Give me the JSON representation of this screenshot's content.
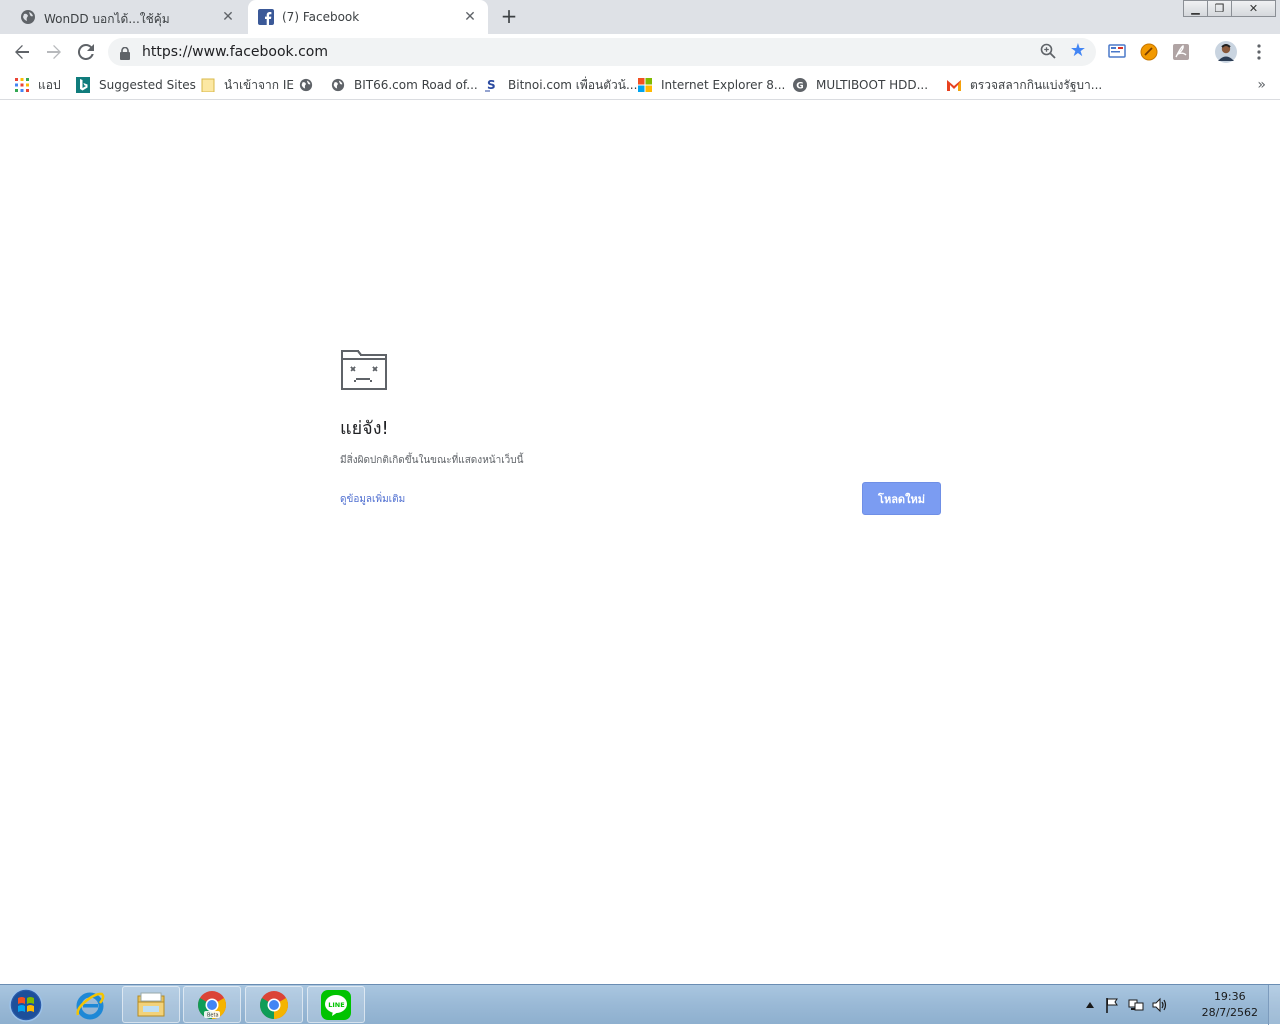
{
  "browser": {
    "tabs": [
      {
        "title": "WonDD บอกได้...ใช้คุ้ม",
        "favicon": "globe-icon",
        "active": false
      },
      {
        "title": "(7) Facebook",
        "favicon": "facebook-icon",
        "active": true
      }
    ],
    "new_tab_label": "+",
    "window_controls": {
      "minimize": "▁",
      "restore": "❐",
      "close": "✕"
    },
    "address_bar": {
      "url": "https://www.facebook.com"
    },
    "bookmarks": [
      {
        "label": "แอป",
        "icon": "apps-grid-icon"
      },
      {
        "label": "Suggested Sites",
        "icon": "bing-icon"
      },
      {
        "label": "นำเข้าจาก IE",
        "icon": "folder-icon"
      },
      {
        "label": "",
        "icon": "globe-icon"
      },
      {
        "label": "BIT66.com Road of...",
        "icon": "globe-icon"
      },
      {
        "label": "Bitnoi.com เพื่อนตัวน้...",
        "icon": "bitnoi-icon"
      },
      {
        "label": "Internet Explorer 8...",
        "icon": "windows-logo-icon"
      },
      {
        "label": "MULTIBOOT HDD...",
        "icon": "g-logo-icon"
      },
      {
        "label": "ตรวจสลากกินแบ่งรัฐบา...",
        "icon": "m-logo-icon"
      }
    ],
    "bookmarks_overflow": "»"
  },
  "error_page": {
    "heading": "แย่จัง!",
    "message": "มีสิ่งผิดปกติเกิดขึ้นในขณะที่แสดงหน้าเว็บนี้",
    "details_link": "ดูข้อมูลเพิ่มเติม",
    "reload_button": "โหลดใหม่"
  },
  "taskbar": {
    "pinned": [
      "internet-explorer-icon",
      "file-explorer-icon",
      "chrome-beta-icon",
      "chrome-icon",
      "line-icon"
    ],
    "chrome_beta_badge": "Beta",
    "line_label": "LINE",
    "clock": {
      "time": "19:36",
      "date": "28/7/2562"
    }
  },
  "colors": {
    "tabstrip": "#dee1e6",
    "omnibox": "#f1f3f4",
    "accent_star": "#4285f4",
    "reload_button": "#7b9cf2",
    "link": "#4f6fd1",
    "taskbar": "#9ab9d6"
  }
}
